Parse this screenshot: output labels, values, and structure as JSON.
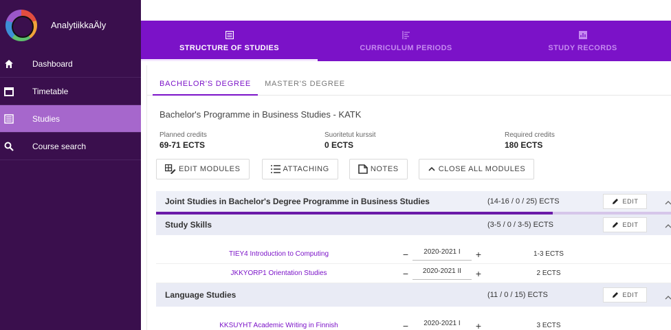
{
  "app": {
    "name": "AnalytiikkaÄly"
  },
  "sidebar": {
    "items": [
      {
        "label": "Dashboard",
        "icon": "home-icon"
      },
      {
        "label": "Timetable",
        "icon": "calendar-icon"
      },
      {
        "label": "Studies",
        "icon": "list-icon",
        "active": true
      },
      {
        "label": "Course search",
        "icon": "search-icon"
      }
    ]
  },
  "top_tabs": [
    {
      "label": "STRUCTURE OF STUDIES",
      "icon": "list-icon",
      "active": true
    },
    {
      "label": "CURRICULUM PERIODS",
      "icon": "align-left-icon"
    },
    {
      "label": "STUDY RECORDS",
      "icon": "bar-chart-icon"
    }
  ],
  "degree_tabs": [
    {
      "label": "BACHELOR'S DEGREE",
      "active": true
    },
    {
      "label": "MASTER'S DEGREE"
    }
  ],
  "programme": {
    "title": "Bachelor's Programme in Business Studies - KATK"
  },
  "credits": {
    "planned": {
      "label": "Planned credits",
      "value": "69-71 ECTS"
    },
    "completed": {
      "label": "Suoritetut kurssit",
      "value": "0 ECTS"
    },
    "required": {
      "label": "Required credits",
      "value": "180 ECTS"
    }
  },
  "actions": {
    "edit_modules": "EDIT MODULES",
    "attaching": "ATTACHING",
    "notes": "NOTES",
    "close_all": "CLOSE ALL MODULES"
  },
  "modules": {
    "joint": {
      "title": "Joint Studies in Bachelor's Degree Programme in Business Studies",
      "ects": "(14-16 / 0 / 25) ECTS",
      "edit": "EDIT",
      "progress": 0.77
    },
    "study_skills": {
      "title": "Study Skills",
      "ects": "(3-5 / 0 / 3-5) ECTS",
      "edit": "EDIT"
    },
    "language": {
      "title": "Language Studies",
      "ects": "(11 / 0 / 15) ECTS",
      "edit": "EDIT"
    }
  },
  "courses": {
    "tiey4": {
      "name": "TIEY4 Introduction to Computing",
      "period": "2020-2021 I",
      "ects": "1-3 ECTS"
    },
    "jkkyorp1": {
      "name": "JKKYORP1 Orientation Studies",
      "period": "2020-2021 II",
      "ects": "2 ECTS"
    },
    "kksuyht": {
      "name": "KKSUYHT Academic Writing in Finnish",
      "period": "2020-2021 I",
      "ects": "3 ECTS"
    }
  },
  "symbols": {
    "minus": "−",
    "plus": "+"
  },
  "colors": {
    "sidebar": "#3a0f4d",
    "active_nav": "#a667cc",
    "topbar": "#7b12c8",
    "link": "#7b12c8"
  }
}
